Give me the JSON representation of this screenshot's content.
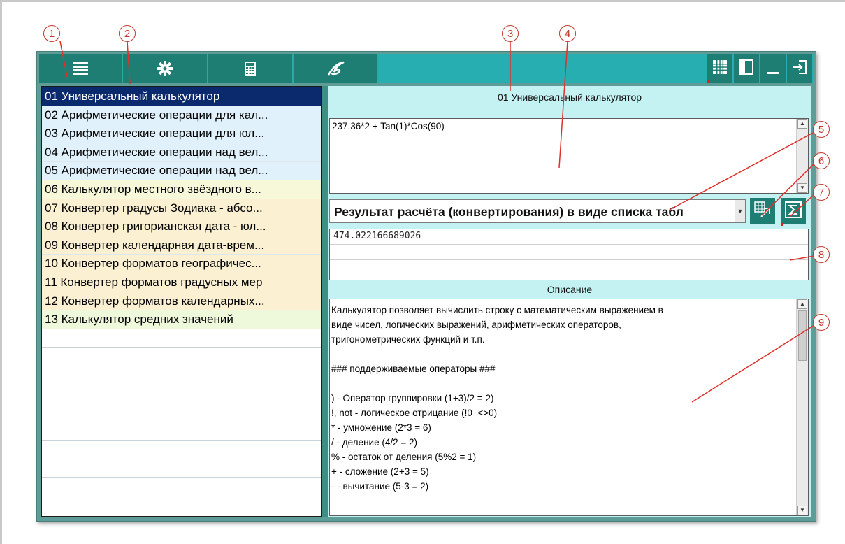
{
  "callouts": [
    "1",
    "2",
    "3",
    "4",
    "5",
    "6",
    "7",
    "8",
    "9"
  ],
  "toolbar": {
    "icons": [
      "menu-icon",
      "gear-icon",
      "calculator-icon",
      "logo-icon",
      "grid-icon",
      "panel-icon",
      "minimize-icon",
      "exit-icon"
    ]
  },
  "list": {
    "items": [
      {
        "label": "01 Универсальный калькулятор",
        "color": "#0b2a6e"
      },
      {
        "label": "02 Арифметические операции для кал...",
        "color": "#e0f1fb"
      },
      {
        "label": "03 Арифметические операции для юл...",
        "color": "#e0f1fb"
      },
      {
        "label": "04 Арифметические операции над вел...",
        "color": "#e0f1fb"
      },
      {
        "label": "05 Арифметические операции над вел...",
        "color": "#e0f1fb"
      },
      {
        "label": "06 Калькулятор местного звёздного в...",
        "color": "#f6f8d9"
      },
      {
        "label": "07 Конвертер градусы Зодиака - абсо...",
        "color": "#fbf1d2"
      },
      {
        "label": "08 Конвертер григорианская дата - юл...",
        "color": "#fbf1d2"
      },
      {
        "label": "09 Конвертер календарная дата-врем...",
        "color": "#fbf1d2"
      },
      {
        "label": "10 Конвертер форматов географичес...",
        "color": "#fbf1d2"
      },
      {
        "label": "11 Конвертер форматов градусных мер",
        "color": "#fbf1d2"
      },
      {
        "label": "12 Конвертер форматов календарных...",
        "color": "#fbf1d2"
      },
      {
        "label": "13 Калькулятор средних значений",
        "color": "#eef8da"
      }
    ]
  },
  "main": {
    "title": "01 Универсальный калькулятор",
    "expression": "237.36*2 + Tan(1)*Cos(90)",
    "result_mode": "Результат расчёта (конвертирования) в виде списка табл",
    "result_value": "474.022166689026",
    "description_label": "Описание",
    "description_lines": [
      "Калькулятор позволяет вычислить строку с математическим выражением в",
      "виде чисел, логических выражений, арифметических операторов,",
      "тригонометрических функций и т.п.",
      "",
      "### поддерживаемые операторы ###",
      "",
      ") - Оператор группировки (1+3)/2 = 2)",
      "!, not - логическое отрицание (!0  <>0)",
      "* - умножение (2*3 = 6)",
      "/ - деление (4/2 = 2)",
      "% - остаток от деления (5%2 = 1)",
      "+ - сложение (2+3 = 5)",
      "- - вычитание (5-3 = 2)"
    ]
  }
}
